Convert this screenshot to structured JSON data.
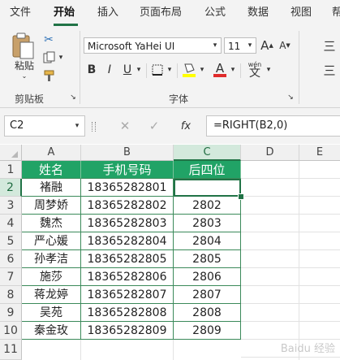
{
  "menu": {
    "file": "文件",
    "home": "开始",
    "insert": "插入",
    "layout": "页面布局",
    "formulas": "公式",
    "data": "数据",
    "view": "视图",
    "more": "帮"
  },
  "ribbon": {
    "paste_label": "粘贴",
    "clipboard_group": "剪贴板",
    "font_name": "Microsoft YaHei UI",
    "font_size": "11",
    "bold": "B",
    "italic": "I",
    "underline": "U",
    "font_group": "字体",
    "grow_font": "A",
    "shrink_font": "A",
    "wen": "wén",
    "wen_char": "文",
    "font_color_letter": "A",
    "highlight_color": "#ffff00",
    "font_color": "#e02b2b",
    "right_chars": [
      "三",
      "三"
    ]
  },
  "formula_bar": {
    "name_box": "C2",
    "fx": "fx",
    "formula": "=RIGHT(B2,0)"
  },
  "sheet": {
    "columns": [
      "A",
      "B",
      "C",
      "D",
      "E"
    ],
    "rows": [
      "1",
      "2",
      "3",
      "4",
      "5",
      "6",
      "7",
      "8",
      "9",
      "10",
      "11"
    ],
    "headers": [
      "姓名",
      "手机号码",
      "后四位"
    ],
    "data": [
      [
        "褚融",
        "18365282801",
        ""
      ],
      [
        "周梦娇",
        "18365282802",
        "2802"
      ],
      [
        "魏杰",
        "18365282803",
        "2803"
      ],
      [
        "严心媛",
        "18365282804",
        "2804"
      ],
      [
        "孙孝洁",
        "18365282805",
        "2805"
      ],
      [
        "施莎",
        "18365282806",
        "2806"
      ],
      [
        "蒋龙婷",
        "18365282807",
        "2807"
      ],
      [
        "吴苑",
        "18365282808",
        "2808"
      ],
      [
        "秦金玫",
        "18365282809",
        "2809"
      ]
    ],
    "header_color": "#21a366",
    "accent_color": "#217346"
  },
  "watermark": "Baidu 经验"
}
